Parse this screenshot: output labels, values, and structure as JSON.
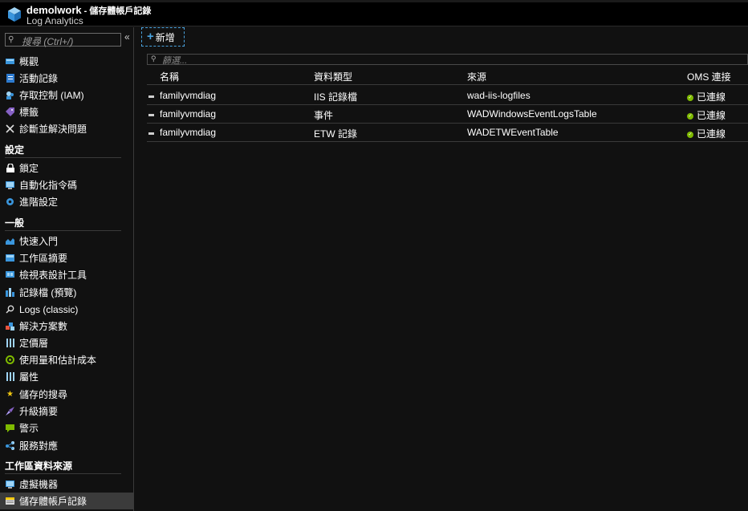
{
  "header": {
    "title_main": "demolwork",
    "title_sub": " - 儲存體帳戶記錄",
    "subtitle": "Log Analytics",
    "logo_icon": "log-analytics-cube-icon"
  },
  "sidebar": {
    "search_placeholder": "搜尋 (Ctrl+/)",
    "collapse_label": "«",
    "top_items": [
      {
        "label": "概觀",
        "icon": "overview-icon"
      },
      {
        "label": "活動記錄",
        "icon": "activity-log-icon"
      },
      {
        "label": "存取控制 (IAM)",
        "icon": "iam-icon"
      },
      {
        "label": "標籤",
        "icon": "tag-icon"
      },
      {
        "label": "診斷並解決問題",
        "icon": "wrench-icon"
      }
    ],
    "sections": [
      {
        "title": "設定",
        "items": [
          {
            "label": "鎖定",
            "icon": "lock-icon"
          },
          {
            "label": "自動化指令碼",
            "icon": "automation-icon"
          },
          {
            "label": "進階設定",
            "icon": "gear-icon"
          }
        ]
      },
      {
        "title": "一般",
        "items": [
          {
            "label": "快速入門",
            "icon": "quickstart-icon"
          },
          {
            "label": "工作區摘要",
            "icon": "workspace-summary-icon"
          },
          {
            "label": "檢視表設計工具",
            "icon": "view-designer-icon"
          },
          {
            "label": "記錄檔 (預覽)",
            "icon": "logs-preview-icon"
          },
          {
            "label": "Logs (classic)",
            "icon": "search-icon"
          },
          {
            "label": "解決方案數",
            "icon": "solutions-icon"
          },
          {
            "label": "定價層",
            "icon": "pricing-icon"
          },
          {
            "label": "使用量和估計成本",
            "icon": "usage-icon"
          },
          {
            "label": "屬性",
            "icon": "properties-icon"
          },
          {
            "label": "儲存的搜尋",
            "icon": "star-icon"
          },
          {
            "label": "升級摘要",
            "icon": "rocket-icon"
          },
          {
            "label": "警示",
            "icon": "alert-icon"
          },
          {
            "label": "服務對應",
            "icon": "service-map-icon"
          }
        ]
      },
      {
        "title": "工作區資料來源",
        "items": [
          {
            "label": "虛擬機器",
            "icon": "vm-icon"
          },
          {
            "label": "儲存體帳戶記錄",
            "icon": "storage-icon",
            "active": true
          }
        ]
      }
    ]
  },
  "toolbar": {
    "add_label": "新增",
    "add_icon": "plus-icon"
  },
  "filter": {
    "placeholder": "篩選..."
  },
  "table": {
    "columns": [
      "名稱",
      "資料類型",
      "來源",
      "OMS 連接"
    ],
    "rows": [
      {
        "name": "familyvmdiag",
        "type": "IIS 記錄檔",
        "source": "wad-iis-logfiles",
        "status": "已連線"
      },
      {
        "name": "familyvmdiag",
        "type": "事件",
        "source": "WADWindowsEventLogsTable",
        "status": "已連線"
      },
      {
        "name": "familyvmdiag",
        "type": "ETW 記錄",
        "source": "WADETWEventTable",
        "status": "已連線"
      }
    ]
  },
  "colors": {
    "accent": "#4aa3df",
    "status_ok": "#7fba00",
    "background": "#111111",
    "active_item": "#3b3b3b"
  }
}
